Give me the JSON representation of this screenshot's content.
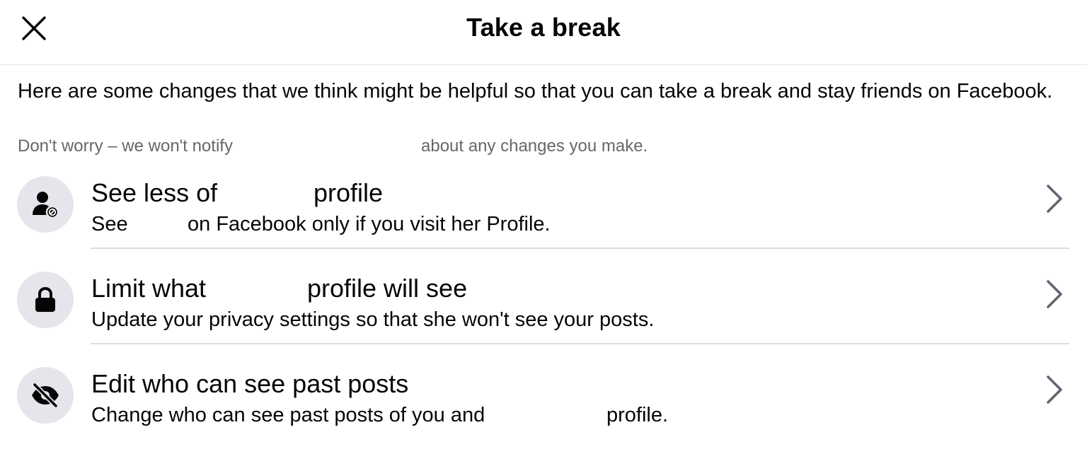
{
  "header": {
    "title": "Take a break",
    "close_icon": "close-icon"
  },
  "intro": {
    "text": "Here are some changes that we think might be helpful so that you can take a break and stay friends on Facebook.",
    "note_part1": "Don't worry – we won't notify",
    "note_part2": "about any changes you make."
  },
  "options": [
    {
      "icon": "person-hidden-icon",
      "title_part1": "See less of",
      "title_part2": "profile",
      "sub_part1": "See",
      "sub_part2": "on Facebook only if you visit her Profile."
    },
    {
      "icon": "lock-icon",
      "title_part1": "Limit what",
      "title_part2": "profile will see",
      "sub": "Update your privacy settings so that she won't see your posts."
    },
    {
      "icon": "eye-slash-icon",
      "title": "Edit who can see past posts",
      "sub_part1": "Change who can see past posts of you and",
      "sub_part2": "profile."
    }
  ],
  "colors": {
    "icon_bg": "#e4e6eb",
    "secondary_text": "#65676b",
    "divider": "#dadde1",
    "chevron": "#606770"
  }
}
